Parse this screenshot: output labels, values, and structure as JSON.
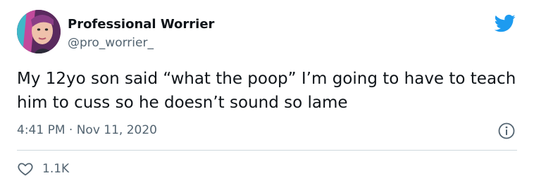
{
  "author": {
    "display_name": "Professional Worrier",
    "handle": "@pro_worrier_"
  },
  "tweet": {
    "text": "My 12yo son said “what the poop” I’m going to have to teach him to cuss so he doesn’t sound so lame",
    "timestamp": "4:41 PM · Nov 11, 2020"
  },
  "actions": {
    "like_count": "1.1K"
  },
  "icons": {
    "brand": "twitter-bird-icon",
    "info": "info-icon",
    "like": "heart-icon"
  },
  "colors": {
    "brand": "#1d9bf0",
    "text": "#0f1419",
    "secondary": "#536471",
    "divider": "#cfd9de"
  }
}
